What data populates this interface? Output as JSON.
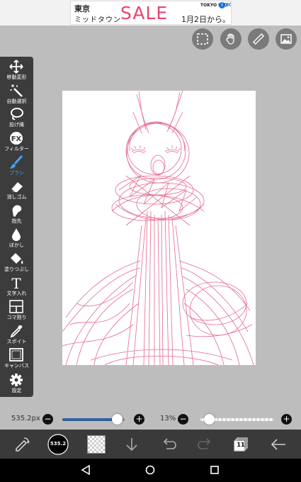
{
  "ad": {
    "line1": "東京",
    "line2": "ミッドタウン",
    "sale": "SALE",
    "date": "1月2日から。",
    "brand": "TOKYO MID",
    "info": "i",
    "close": "✕"
  },
  "top_buttons": [
    "selection-icon",
    "hand-icon",
    "ruler-icon",
    "layer-image-icon"
  ],
  "tools": [
    {
      "name": "move",
      "label": "移動変形",
      "icon": "move-icon"
    },
    {
      "name": "magic-wand",
      "label": "自動選択",
      "icon": "magic-wand-icon"
    },
    {
      "name": "lasso",
      "label": "投げ縄",
      "icon": "lasso-icon"
    },
    {
      "name": "filter",
      "label": "フィルター",
      "icon": "fx-icon"
    },
    {
      "name": "brush",
      "label": "ブラシ",
      "icon": "brush-icon",
      "active": true
    },
    {
      "name": "eraser",
      "label": "消しゴム",
      "icon": "eraser-icon"
    },
    {
      "name": "smudge",
      "label": "指先",
      "icon": "smudge-icon"
    },
    {
      "name": "blur",
      "label": "ぼかし",
      "icon": "blur-drop-icon"
    },
    {
      "name": "fill",
      "label": "塗りつぶし",
      "icon": "bucket-icon"
    },
    {
      "name": "text",
      "label": "文字入れ",
      "icon": "text-icon"
    },
    {
      "name": "frame-divider",
      "label": "コマ割り",
      "icon": "frame-icon"
    },
    {
      "name": "eyedropper",
      "label": "スポイト",
      "icon": "eyedropper-icon"
    },
    {
      "name": "canvas",
      "label": "キャンバス",
      "icon": "canvas-icon"
    },
    {
      "name": "settings",
      "label": "設定",
      "icon": "gear-icon"
    }
  ],
  "brush_size": {
    "label": "535.2px",
    "minus": "−",
    "plus": "+",
    "fraction": 0.88
  },
  "opacity": {
    "label": "13%",
    "minus": "−",
    "plus": "+",
    "fraction": 0.13
  },
  "bottom": {
    "brush_badge": "535.2",
    "layer_count": "11"
  },
  "colors": {
    "accent": "#4da0f0",
    "sketch": "#e0507a",
    "slider_fill": "#2f5fa0"
  }
}
